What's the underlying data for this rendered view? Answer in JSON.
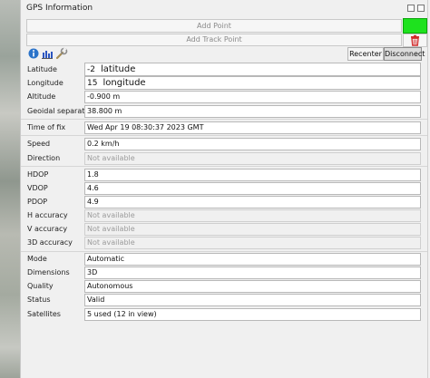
{
  "panel": {
    "title": "GPS Information"
  },
  "buttons": {
    "add_point": "Add Point",
    "add_track_point": "Add Track Point",
    "recenter": "Recenter",
    "disconnect": "Disconnect"
  },
  "colors": {
    "status_green": "#1ee21e",
    "trash_red": "#d22b2b",
    "info_blue": "#2b73c9"
  },
  "icons": [
    "info-icon",
    "signal-bars-icon",
    "wrench-icon",
    "trash-icon"
  ],
  "fields": {
    "latitude": {
      "label": "Latitude",
      "value": "-2",
      "note": "latitude"
    },
    "longitude": {
      "label": "Longitude",
      "value": "15",
      "note": "longitude"
    },
    "altitude": {
      "label": "Altitude",
      "value": "-0.900 m"
    },
    "geoidal": {
      "label": "Geoidal separation",
      "value": "38.800 m"
    },
    "time": {
      "label": "Time of fix",
      "value": "Wed Apr 19 08:30:37 2023 GMT"
    },
    "speed": {
      "label": "Speed",
      "value": "0.2 km/h"
    },
    "direction": {
      "label": "Direction",
      "value": "Not available"
    },
    "hdop": {
      "label": "HDOP",
      "value": "1.8"
    },
    "vdop": {
      "label": "VDOP",
      "value": "4.6"
    },
    "pdop": {
      "label": "PDOP",
      "value": "4.9"
    },
    "h_acc": {
      "label": "H accuracy",
      "value": "Not available"
    },
    "v_acc": {
      "label": "V accuracy",
      "value": "Not available"
    },
    "acc3d": {
      "label": "3D accuracy",
      "value": "Not available"
    },
    "mode": {
      "label": "Mode",
      "value": "Automatic"
    },
    "dimensions": {
      "label": "Dimensions",
      "value": "3D"
    },
    "quality": {
      "label": "Quality",
      "value": "Autonomous"
    },
    "status": {
      "label": "Status",
      "value": "Valid"
    },
    "satellites": {
      "label": "Satellites",
      "value": "5 used (12 in view)"
    }
  }
}
